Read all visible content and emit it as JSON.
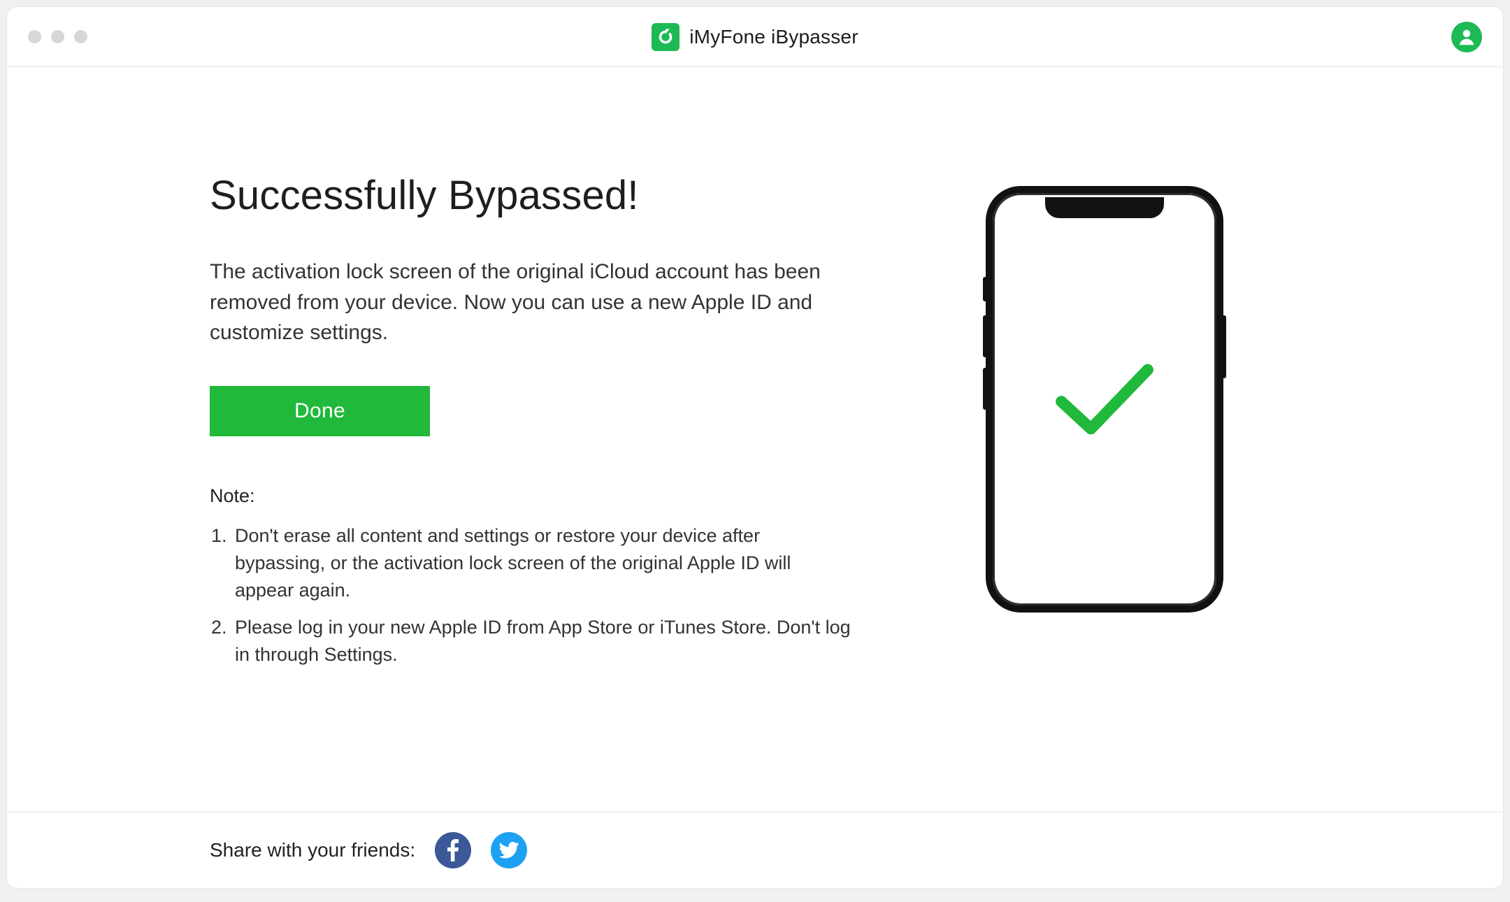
{
  "titlebar": {
    "app_name": "iMyFone iBypasser"
  },
  "main": {
    "heading": "Successfully Bypassed!",
    "description": "The activation lock screen of the original iCloud account has been removed from your device. Now you can use a new Apple ID and customize settings.",
    "done_label": "Done",
    "note_label": "Note:",
    "notes": [
      "Don't erase all content and settings or restore your device after bypassing, or the activation lock screen of the original Apple ID will appear again.",
      "Please log in your new Apple ID from App Store or iTunes Store. Don't log in through Settings."
    ]
  },
  "footer": {
    "share_label": "Share with your friends:"
  },
  "colors": {
    "accent": "#20b93b",
    "facebook": "#3b5998",
    "twitter": "#1da1f2"
  }
}
